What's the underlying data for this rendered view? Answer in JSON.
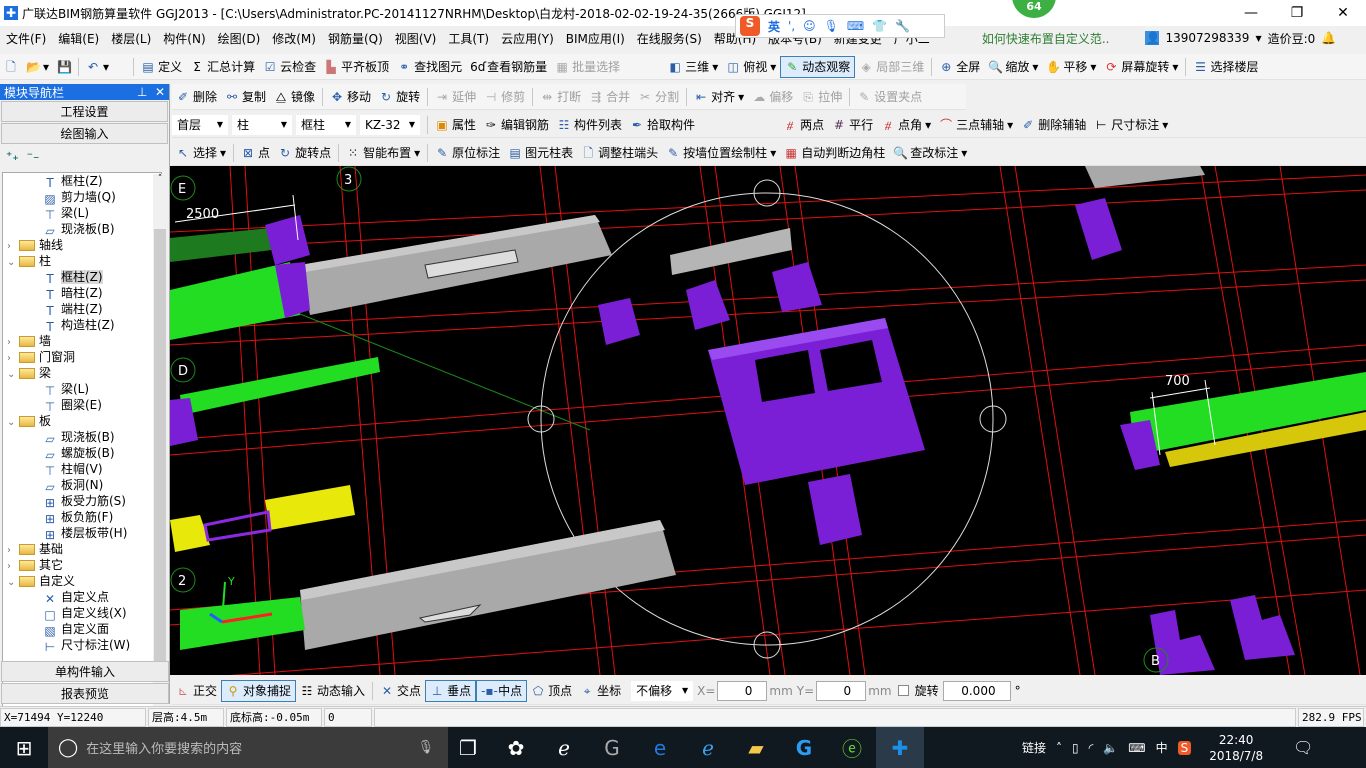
{
  "title": "广联达BIM钢筋算量软件 GGJ2013 - [C:\\Users\\Administrator.PC-20141127NRHM\\Desktop\\白龙村-2018-02-02-19-24-35(2666版).GGJ12]",
  "badge": "64",
  "menu": [
    "文件(F)",
    "编辑(E)",
    "楼层(L)",
    "构件(N)",
    "绘图(D)",
    "修改(M)",
    "钢筋量(Q)",
    "视图(V)",
    "工具(T)",
    "云应用(Y)",
    "BIM应用(I)",
    "在线服务(S)",
    "帮助(H)",
    "版本号(B)",
    "新建变更",
    "广小二"
  ],
  "ime": {
    "label": "英"
  },
  "promo": "如何快速布置自定义范..",
  "account": {
    "phone": "13907298339",
    "beans": "造价豆:0"
  },
  "toolbar1": {
    "items": [
      "定义",
      "汇总计算",
      "云检查",
      "平齐板顶",
      "查找图元",
      "查看钢筋量",
      "批量选择"
    ],
    "view": [
      "三维",
      "俯视",
      "动态观察",
      "局部三维",
      "全屏",
      "缩放",
      "平移",
      "屏幕旋转",
      "选择楼层"
    ]
  },
  "toolbar2": [
    "删除",
    "复制",
    "镜像",
    "移动",
    "旋转",
    "延伸",
    "修剪",
    "打断",
    "合并",
    "分割",
    "对齐",
    "偏移",
    "拉伸",
    "设置夹点"
  ],
  "toolbar3": {
    "floor": "首层",
    "type": "柱",
    "subtype": "框柱",
    "name": "KZ-32",
    "items": [
      "属性",
      "编辑钢筋",
      "构件列表",
      "拾取构件"
    ],
    "axis": [
      "两点",
      "平行",
      "点角",
      "三点辅轴",
      "删除辅轴",
      "尺寸标注"
    ]
  },
  "toolbar4": [
    "选择",
    "点",
    "旋转点",
    "智能布置",
    "原位标注",
    "图元柱表",
    "调整柱端头",
    "按墙位置绘制柱",
    "自动判断边角柱",
    "查改标注"
  ],
  "nav": {
    "title": "模块导航栏",
    "buttons": [
      "工程设置",
      "绘图输入"
    ],
    "bottom": [
      "单构件输入",
      "报表预览"
    ],
    "tree": [
      {
        "l": "框柱(Z)",
        "d": 2,
        "i": "column-icon"
      },
      {
        "l": "剪力墙(Q)",
        "d": 2,
        "i": "wall-icon"
      },
      {
        "l": "梁(L)",
        "d": 2,
        "i": "beam-icon"
      },
      {
        "l": "现浇板(B)",
        "d": 2,
        "i": "slab-icon"
      },
      {
        "l": "轴线",
        "d": 1,
        "f": "c"
      },
      {
        "l": "柱",
        "d": 1,
        "f": "o"
      },
      {
        "l": "框柱(Z)",
        "d": 2,
        "i": "column-icon",
        "sel": true
      },
      {
        "l": "暗柱(Z)",
        "d": 2,
        "i": "column-icon"
      },
      {
        "l": "端柱(Z)",
        "d": 2,
        "i": "column-icon"
      },
      {
        "l": "构造柱(Z)",
        "d": 2,
        "i": "column-icon"
      },
      {
        "l": "墙",
        "d": 1,
        "f": "c"
      },
      {
        "l": "门窗洞",
        "d": 1,
        "f": "c"
      },
      {
        "l": "梁",
        "d": 1,
        "f": "o"
      },
      {
        "l": "梁(L)",
        "d": 2,
        "i": "beam-icon"
      },
      {
        "l": "圈梁(E)",
        "d": 2,
        "i": "beam-icon"
      },
      {
        "l": "板",
        "d": 1,
        "f": "o"
      },
      {
        "l": "现浇板(B)",
        "d": 2,
        "i": "slab-icon"
      },
      {
        "l": "螺旋板(B)",
        "d": 2,
        "i": "slab-icon"
      },
      {
        "l": "柱帽(V)",
        "d": 2,
        "i": "cap-icon"
      },
      {
        "l": "板洞(N)",
        "d": 2,
        "i": "slab-icon"
      },
      {
        "l": "板受力筋(S)",
        "d": 2,
        "i": "rebar-icon"
      },
      {
        "l": "板负筋(F)",
        "d": 2,
        "i": "rebar-icon"
      },
      {
        "l": "楼层板带(H)",
        "d": 2,
        "i": "rebar-icon"
      },
      {
        "l": "基础",
        "d": 1,
        "f": "c"
      },
      {
        "l": "其它",
        "d": 1,
        "f": "c"
      },
      {
        "l": "自定义",
        "d": 1,
        "f": "o"
      },
      {
        "l": "自定义点",
        "d": 2,
        "i": "point-icon"
      },
      {
        "l": "自定义线(X)",
        "d": 2,
        "i": "line-icon"
      },
      {
        "l": "自定义面",
        "d": 2,
        "i": "area-icon"
      },
      {
        "l": "尺寸标注(W)",
        "d": 2,
        "i": "dimension-icon"
      }
    ]
  },
  "viewport": {
    "labels": {
      "axis_e": "E",
      "axis_3": "3",
      "axis_d": "D",
      "axis_2": "2",
      "axis_b": "B",
      "dim1": "2500",
      "dim2": "700",
      "y_axis": "Y"
    }
  },
  "snapbar": {
    "items": [
      "正交",
      "对象捕捉",
      "动态输入",
      "交点",
      "垂点",
      "中点",
      "顶点",
      "坐标"
    ],
    "offset": "不偏移",
    "x_label": "X=",
    "x": "0",
    "y_label": "Y=",
    "y": "0",
    "unit": "mm",
    "rotate_label": "旋转",
    "rotate": "0.000",
    "deg": "°"
  },
  "status": {
    "coords": "X=71494 Y=12240",
    "floor_h": "层高:4.5m",
    "base_h": "底标高:-0.05m",
    "val": "0",
    "fps": "282.9 FPS"
  },
  "taskbar": {
    "search": "在这里输入你要搜索的内容",
    "link": "链接",
    "lang": "中",
    "time": "22:40",
    "date": "2018/7/8"
  }
}
